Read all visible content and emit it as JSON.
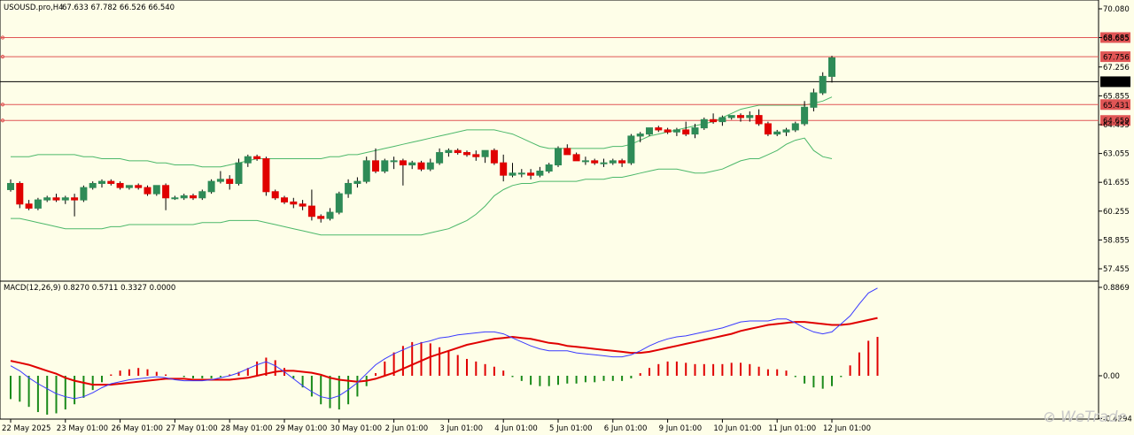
{
  "header": {
    "title": "USOUSD.pro,H4",
    "ohlc": "67.633 67.782 66.526 66.540"
  },
  "macd_header": {
    "label": "MACD(12,26,9) 0.8270 0.5711 0.3327 0.0000"
  },
  "watermark": "WeTrade",
  "colors": {
    "bg": "#fefee8",
    "up": "#2e8b57",
    "down": "#e00000",
    "bands": "#4cb86a",
    "hline": "#e05555",
    "current": "#000000",
    "macd": "#3a3aff",
    "signal": "#e00000",
    "hist_pos": "#e00000",
    "hist_neg": "#1a8a1a"
  },
  "chart_data": [
    {
      "type": "candlestick",
      "title": "USOUSD.pro,H4",
      "y_ticks": [
        "70.080",
        "68.685",
        "67.256",
        "65.855",
        "64.455",
        "63.055",
        "61.655",
        "60.255",
        "58.855",
        "57.455"
      ],
      "ylim": [
        56.5,
        70.5
      ],
      "x_ticks": [
        "22 May 2025",
        "23 May 01:00",
        "26 May 01:00",
        "27 May 01:00",
        "28 May 01:00",
        "29 May 01:00",
        "30 May 01:00",
        "2 Jun 01:00",
        "3 Jun 01:00",
        "4 Jun 01:00",
        "5 Jun 01:00",
        "6 Jun 01:00",
        "9 Jun 01:00",
        "10 Jun 01:00",
        "11 Jun 01:00",
        "12 Jun 01:00"
      ],
      "hlines": [
        {
          "value": 68.685,
          "label": "68.685"
        },
        {
          "value": 67.756,
          "label": "67.756"
        },
        {
          "value": 65.431,
          "label": "65.431"
        },
        {
          "value": 64.659,
          "label": "64.659"
        }
      ],
      "current_price": {
        "value": 66.54,
        "label": "66.540"
      },
      "candles": [
        [
          61.3,
          61.8,
          61.2,
          61.6
        ],
        [
          61.6,
          61.7,
          60.4,
          60.6
        ],
        [
          60.6,
          60.8,
          60.3,
          60.4
        ],
        [
          60.4,
          60.9,
          60.3,
          60.8
        ],
        [
          60.8,
          61.0,
          60.7,
          60.9
        ],
        [
          60.9,
          61.1,
          60.7,
          60.8
        ],
        [
          60.8,
          61.0,
          60.6,
          60.9
        ],
        [
          60.9,
          61.1,
          60.0,
          60.8
        ],
        [
          60.8,
          61.5,
          60.7,
          61.4
        ],
        [
          61.4,
          61.7,
          61.3,
          61.6
        ],
        [
          61.6,
          61.8,
          61.4,
          61.7
        ],
        [
          61.7,
          61.8,
          61.5,
          61.6
        ],
        [
          61.6,
          61.7,
          61.3,
          61.4
        ],
        [
          61.4,
          61.5,
          61.3,
          61.5
        ],
        [
          61.5,
          61.6,
          61.3,
          61.4
        ],
        [
          61.4,
          61.5,
          61.0,
          61.1
        ],
        [
          61.1,
          61.5,
          61.0,
          61.5
        ],
        [
          61.5,
          61.6,
          60.3,
          60.9
        ],
        [
          60.9,
          61.0,
          60.8,
          60.9
        ],
        [
          60.9,
          61.1,
          60.8,
          61.0
        ],
        [
          61.0,
          61.1,
          60.8,
          60.9
        ],
        [
          60.9,
          61.3,
          60.8,
          61.2
        ],
        [
          61.2,
          61.8,
          61.1,
          61.7
        ],
        [
          61.7,
          62.2,
          61.6,
          61.8
        ],
        [
          61.8,
          62.0,
          61.3,
          61.6
        ],
        [
          61.6,
          62.8,
          61.5,
          62.6
        ],
        [
          62.6,
          63.0,
          62.4,
          62.9
        ],
        [
          62.9,
          63.0,
          62.7,
          62.8
        ],
        [
          62.8,
          62.9,
          61.0,
          61.2
        ],
        [
          61.2,
          61.3,
          60.8,
          60.9
        ],
        [
          60.9,
          61.0,
          60.6,
          60.7
        ],
        [
          60.7,
          60.9,
          60.4,
          60.6
        ],
        [
          60.6,
          60.8,
          60.3,
          60.5
        ],
        [
          60.5,
          61.3,
          59.8,
          60.0
        ],
        [
          60.0,
          60.1,
          59.7,
          59.9
        ],
        [
          59.9,
          60.4,
          59.8,
          60.2
        ],
        [
          60.2,
          61.2,
          60.1,
          61.1
        ],
        [
          61.1,
          61.8,
          60.9,
          61.6
        ],
        [
          61.6,
          61.9,
          61.4,
          61.7
        ],
        [
          61.7,
          62.9,
          61.6,
          62.7
        ],
        [
          62.7,
          63.3,
          62.1,
          62.2
        ],
        [
          62.2,
          62.8,
          62.1,
          62.7
        ],
        [
          62.7,
          62.9,
          62.3,
          62.7
        ],
        [
          62.7,
          62.8,
          61.5,
          62.5
        ],
        [
          62.5,
          62.7,
          62.3,
          62.6
        ],
        [
          62.6,
          62.7,
          62.2,
          62.3
        ],
        [
          62.3,
          62.8,
          62.2,
          62.6
        ],
        [
          62.6,
          63.3,
          62.5,
          63.1
        ],
        [
          63.1,
          63.3,
          62.9,
          63.2
        ],
        [
          63.2,
          63.3,
          63.0,
          63.1
        ],
        [
          63.1,
          63.2,
          62.9,
          63.0
        ],
        [
          63.0,
          63.2,
          62.7,
          62.9
        ],
        [
          62.9,
          63.2,
          62.6,
          63.2
        ],
        [
          63.2,
          63.3,
          62.5,
          62.6
        ],
        [
          62.6,
          63.0,
          61.7,
          62.0
        ],
        [
          62.0,
          62.6,
          61.9,
          62.1
        ],
        [
          62.1,
          62.3,
          61.9,
          62.1
        ],
        [
          62.1,
          62.3,
          61.8,
          62.0
        ],
        [
          62.0,
          62.4,
          61.9,
          62.2
        ],
        [
          62.2,
          62.6,
          62.1,
          62.5
        ],
        [
          62.5,
          63.4,
          62.4,
          63.3
        ],
        [
          63.3,
          63.5,
          63.0,
          63.0
        ],
        [
          63.0,
          63.1,
          62.7,
          62.7
        ],
        [
          62.7,
          62.9,
          62.5,
          62.7
        ],
        [
          62.7,
          62.8,
          62.5,
          62.6
        ],
        [
          62.6,
          62.8,
          62.4,
          62.6
        ],
        [
          62.6,
          62.8,
          62.5,
          62.7
        ],
        [
          62.7,
          62.8,
          62.4,
          62.6
        ],
        [
          62.6,
          64.0,
          62.5,
          63.9
        ],
        [
          63.9,
          64.1,
          63.6,
          64.0
        ],
        [
          64.0,
          64.3,
          63.9,
          64.3
        ],
        [
          64.3,
          64.4,
          64.1,
          64.2
        ],
        [
          64.2,
          64.3,
          64.0,
          64.1
        ],
        [
          64.1,
          64.3,
          63.9,
          64.2
        ],
        [
          64.2,
          64.6,
          63.9,
          64.0
        ],
        [
          64.0,
          64.5,
          63.8,
          64.3
        ],
        [
          64.3,
          64.8,
          64.2,
          64.7
        ],
        [
          64.7,
          65.0,
          64.5,
          64.6
        ],
        [
          64.6,
          64.9,
          64.4,
          64.8
        ],
        [
          64.8,
          64.9,
          64.7,
          64.9
        ],
        [
          64.9,
          65.0,
          64.6,
          64.8
        ],
        [
          64.8,
          65.1,
          64.6,
          64.9
        ],
        [
          64.9,
          65.2,
          64.4,
          64.5
        ],
        [
          64.5,
          64.6,
          63.9,
          64.0
        ],
        [
          64.0,
          64.2,
          63.9,
          64.1
        ],
        [
          64.1,
          64.3,
          63.9,
          64.2
        ],
        [
          64.2,
          64.6,
          64.1,
          64.5
        ],
        [
          64.5,
          65.6,
          64.4,
          65.3
        ],
        [
          65.3,
          66.2,
          65.1,
          66.0
        ],
        [
          66.0,
          67.0,
          65.9,
          66.8
        ],
        [
          66.8,
          67.8,
          66.5,
          67.7
        ]
      ],
      "bollinger": {
        "upper": [
          62.9,
          62.9,
          62.9,
          63.0,
          63.0,
          63.0,
          63.0,
          63.0,
          62.9,
          62.9,
          62.8,
          62.8,
          62.8,
          62.7,
          62.7,
          62.7,
          62.6,
          62.6,
          62.5,
          62.5,
          62.5,
          62.4,
          62.4,
          62.4,
          62.5,
          62.6,
          62.7,
          62.8,
          62.8,
          62.8,
          62.8,
          62.8,
          62.8,
          62.8,
          62.8,
          62.9,
          62.9,
          63.0,
          63.0,
          63.1,
          63.2,
          63.3,
          63.4,
          63.5,
          63.6,
          63.7,
          63.8,
          63.9,
          64.0,
          64.1,
          64.2,
          64.2,
          64.2,
          64.2,
          64.1,
          64.0,
          63.8,
          63.6,
          63.4,
          63.3,
          63.3,
          63.3,
          63.3,
          63.3,
          63.3,
          63.3,
          63.4,
          63.4,
          63.5,
          63.7,
          63.9,
          64.0,
          64.1,
          64.2,
          64.3,
          64.4,
          64.5,
          64.6,
          64.8,
          65.0,
          65.2,
          65.3,
          65.4,
          65.4,
          65.4,
          65.4,
          65.4,
          65.4,
          65.5,
          65.6,
          65.8
        ],
        "middle": [
          61.4,
          61.4,
          61.3,
          61.3,
          61.3,
          61.2,
          61.2,
          61.2,
          61.2,
          61.2,
          61.2,
          61.2,
          61.2,
          61.2,
          61.1,
          61.1,
          61.1,
          61.1,
          61.1,
          61.1,
          61.1,
          61.1,
          61.1,
          61.1,
          61.2,
          61.2,
          61.3,
          61.4,
          61.4,
          61.4,
          61.4,
          61.4,
          61.4,
          61.4,
          61.3,
          61.3,
          61.3,
          61.4,
          61.5,
          61.6,
          61.7,
          61.8,
          61.9,
          62.0,
          62.1,
          62.2,
          62.3,
          62.3,
          62.4,
          62.5,
          62.6,
          62.6,
          62.6,
          62.6,
          62.6,
          62.6,
          62.5,
          62.5,
          62.5,
          62.5,
          62.5,
          62.5,
          62.5,
          62.6,
          62.6,
          62.6,
          62.6,
          62.7,
          62.8,
          62.9,
          63.0,
          63.1,
          63.2,
          63.3,
          63.4,
          63.5,
          63.6,
          63.7,
          63.8,
          63.9,
          64.0,
          64.1,
          64.2,
          64.3,
          64.3,
          64.3,
          64.3,
          64.4,
          64.5,
          64.6,
          64.7
        ],
        "lower": [
          59.9,
          59.9,
          59.8,
          59.7,
          59.6,
          59.5,
          59.4,
          59.4,
          59.4,
          59.4,
          59.4,
          59.5,
          59.5,
          59.6,
          59.6,
          59.6,
          59.6,
          59.6,
          59.6,
          59.6,
          59.6,
          59.7,
          59.7,
          59.7,
          59.8,
          59.8,
          59.8,
          59.8,
          59.7,
          59.6,
          59.5,
          59.4,
          59.3,
          59.2,
          59.1,
          59.1,
          59.1,
          59.1,
          59.1,
          59.1,
          59.1,
          59.1,
          59.1,
          59.1,
          59.1,
          59.1,
          59.2,
          59.3,
          59.4,
          59.6,
          59.8,
          60.1,
          60.5,
          61.0,
          61.3,
          61.5,
          61.6,
          61.6,
          61.7,
          61.7,
          61.7,
          61.7,
          61.7,
          61.8,
          61.8,
          61.8,
          61.9,
          61.9,
          62.0,
          62.1,
          62.2,
          62.3,
          62.3,
          62.3,
          62.2,
          62.1,
          62.1,
          62.2,
          62.3,
          62.5,
          62.7,
          62.8,
          62.8,
          63.0,
          63.2,
          63.5,
          63.7,
          63.8,
          63.2,
          62.9,
          62.8
        ]
      }
    },
    {
      "type": "macd",
      "title": "MACD(12,26,9) 0.8270 0.5711 0.3327 0.0000",
      "y_ticks": [
        "0.8869",
        "0.00",
        "-0.4294"
      ],
      "ylim": [
        -0.43,
        0.89
      ],
      "macd": [
        0.1,
        0.05,
        -0.02,
        -0.08,
        -0.13,
        -0.18,
        -0.21,
        -0.23,
        -0.21,
        -0.17,
        -0.12,
        -0.08,
        -0.06,
        -0.04,
        -0.03,
        -0.02,
        -0.01,
        -0.02,
        -0.04,
        -0.05,
        -0.05,
        -0.05,
        -0.04,
        -0.02,
        0.0,
        0.03,
        0.07,
        0.11,
        0.14,
        0.1,
        0.04,
        -0.03,
        -0.1,
        -0.16,
        -0.21,
        -0.23,
        -0.2,
        -0.14,
        -0.07,
        0.02,
        0.11,
        0.17,
        0.22,
        0.26,
        0.3,
        0.33,
        0.35,
        0.38,
        0.39,
        0.41,
        0.42,
        0.43,
        0.44,
        0.44,
        0.42,
        0.38,
        0.34,
        0.3,
        0.27,
        0.25,
        0.25,
        0.25,
        0.23,
        0.22,
        0.21,
        0.2,
        0.19,
        0.19,
        0.21,
        0.25,
        0.3,
        0.34,
        0.37,
        0.39,
        0.4,
        0.42,
        0.44,
        0.46,
        0.48,
        0.51,
        0.54,
        0.55,
        0.55,
        0.55,
        0.57,
        0.57,
        0.53,
        0.48,
        0.44,
        0.42,
        0.44,
        0.52,
        0.6,
        0.72,
        0.83,
        0.88
      ],
      "signal": [
        0.15,
        0.13,
        0.11,
        0.08,
        0.05,
        0.02,
        -0.02,
        -0.05,
        -0.07,
        -0.09,
        -0.09,
        -0.09,
        -0.08,
        -0.07,
        -0.06,
        -0.05,
        -0.04,
        -0.03,
        -0.03,
        -0.03,
        -0.04,
        -0.04,
        -0.04,
        -0.04,
        -0.04,
        -0.03,
        -0.02,
        0.0,
        0.02,
        0.04,
        0.05,
        0.05,
        0.04,
        0.03,
        0.01,
        -0.02,
        -0.04,
        -0.05,
        -0.06,
        -0.05,
        -0.03,
        0.0,
        0.03,
        0.07,
        0.11,
        0.15,
        0.19,
        0.22,
        0.25,
        0.28,
        0.31,
        0.33,
        0.35,
        0.37,
        0.38,
        0.39,
        0.38,
        0.37,
        0.35,
        0.33,
        0.32,
        0.3,
        0.29,
        0.28,
        0.27,
        0.26,
        0.25,
        0.24,
        0.23,
        0.23,
        0.24,
        0.26,
        0.28,
        0.3,
        0.32,
        0.34,
        0.36,
        0.38,
        0.4,
        0.42,
        0.45,
        0.47,
        0.49,
        0.51,
        0.52,
        0.53,
        0.54,
        0.54,
        0.53,
        0.52,
        0.51,
        0.51,
        0.52,
        0.54,
        0.56,
        0.58
      ],
      "histogram": [
        -0.18,
        -0.2,
        -0.24,
        -0.28,
        -0.3,
        -0.29,
        -0.26,
        -0.22,
        -0.17,
        -0.11,
        -0.05,
        0.01,
        0.04,
        0.05,
        0.06,
        0.05,
        0.03,
        0.01,
        0.0,
        -0.01,
        -0.02,
        -0.02,
        -0.02,
        -0.01,
        0.01,
        0.03,
        0.06,
        0.11,
        0.14,
        0.12,
        0.06,
        -0.02,
        -0.09,
        -0.16,
        -0.22,
        -0.25,
        -0.26,
        -0.22,
        -0.16,
        -0.08,
        0.02,
        0.11,
        0.18,
        0.23,
        0.26,
        0.26,
        0.25,
        0.22,
        0.19,
        0.16,
        0.13,
        0.11,
        0.09,
        0.07,
        0.04,
        -0.01,
        -0.04,
        -0.07,
        -0.08,
        -0.08,
        -0.07,
        -0.06,
        -0.06,
        -0.05,
        -0.05,
        -0.04,
        -0.04,
        -0.04,
        -0.02,
        0.02,
        0.06,
        0.09,
        0.11,
        0.11,
        0.1,
        0.09,
        0.09,
        0.09,
        0.09,
        0.1,
        0.1,
        0.09,
        0.07,
        0.05,
        0.05,
        0.04,
        -0.01,
        -0.06,
        -0.09,
        -0.1,
        -0.08,
        -0.01,
        0.08,
        0.18,
        0.27,
        0.3
      ]
    }
  ]
}
